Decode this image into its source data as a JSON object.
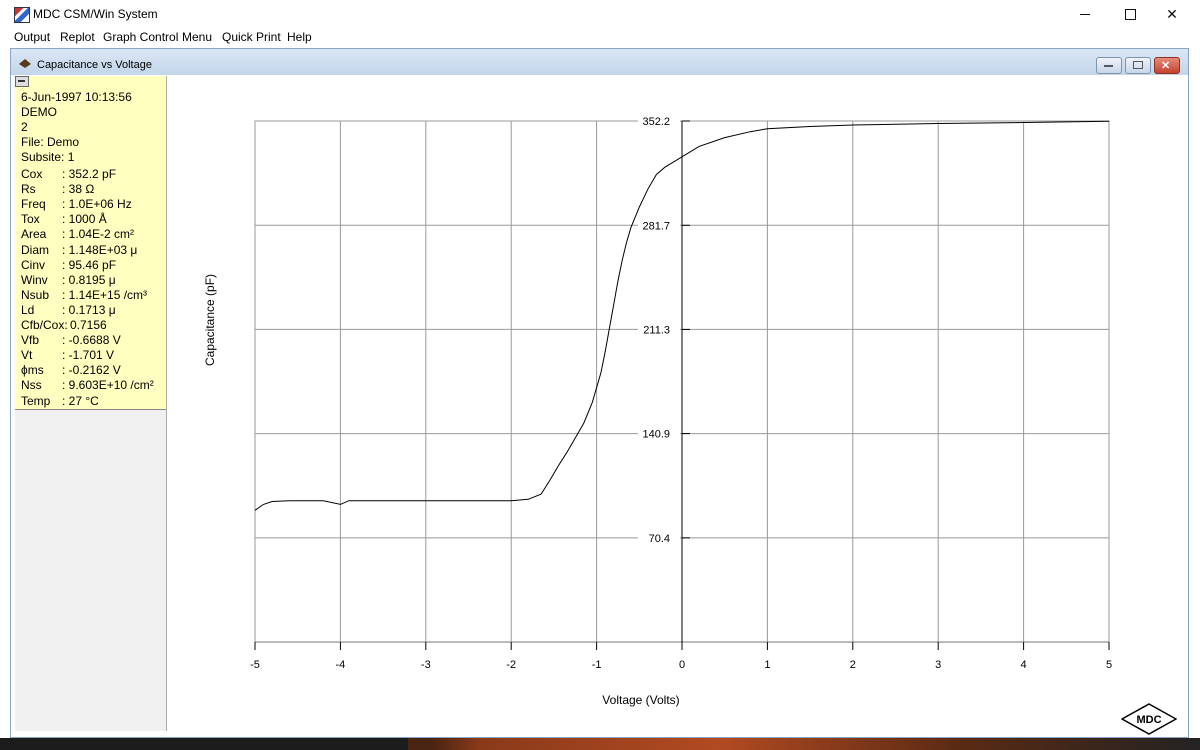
{
  "window": {
    "title": "MDC CSM/Win System"
  },
  "menu": [
    "Output",
    "Replot",
    "Graph Control",
    "Menu",
    "Quick Print",
    "Help"
  ],
  "child_window": {
    "title": "Capacitance vs Voltage"
  },
  "info": {
    "datetime": "6-Jun-1997 10:13:56",
    "name": "DEMO",
    "id": "2",
    "file": "File: Demo",
    "subsite": "Subsite: 1"
  },
  "params": [
    {
      "name": "Cox",
      "value": ": 352.2 pF"
    },
    {
      "name": "Rs",
      "value": ": 38 Ω"
    },
    {
      "name": "Freq",
      "value": ": 1.0E+06 Hz"
    },
    {
      "name": "Tox",
      "value": ": 1000 Å"
    },
    {
      "name": "Area",
      "value": ": 1.04E-2 cm²"
    },
    {
      "name": "Diam",
      "value": ": 1.148E+03 μ"
    },
    {
      "name": "Cinv",
      "value": ": 95.46 pF"
    },
    {
      "name": "Winv",
      "value": ": 0.8195 μ"
    },
    {
      "name": "Nsub",
      "value": ": 1.14E+15 /cm³"
    },
    {
      "name": "Ld",
      "value": ": 0.1713 μ"
    },
    {
      "name": "Cfb/Cox:",
      "value": "0.7156"
    },
    {
      "name": "Vfb",
      "value": ": -0.6688 V"
    },
    {
      "name": "Vt",
      "value": ": -1.701 V"
    },
    {
      "name": "ϕms",
      "value": ": -0.2162 V"
    },
    {
      "name": "Nss",
      "value": ": 9.603E+10 /cm²"
    },
    {
      "name": "Temp",
      "value": ": 27 °C"
    }
  ],
  "logo": {
    "text": "MDC"
  },
  "chart_data": {
    "type": "line",
    "title": "",
    "xlabel": "Voltage (Volts)",
    "ylabel": "Capacitance (pF)",
    "xlim": [
      -5,
      5
    ],
    "ylim": [
      0,
      352.2
    ],
    "x_ticks": [
      -5,
      -4,
      -3,
      -2,
      -1,
      0,
      1,
      2,
      3,
      4,
      5
    ],
    "y_ticks": [
      70.4,
      140.9,
      211.3,
      281.7,
      352.2
    ],
    "grid": true,
    "series": [
      {
        "x": [
          -5,
          -4.9,
          -4.8,
          -4.6,
          -4.2,
          -4.0,
          -3.9,
          -3.0,
          -2.0,
          -1.8,
          -1.65,
          -1.55,
          -1.45,
          -1.35,
          -1.25,
          -1.15,
          -1.05,
          -0.95,
          -0.9,
          -0.85,
          -0.8,
          -0.75,
          -0.7,
          -0.65,
          -0.6,
          -0.5,
          -0.4,
          -0.3,
          -0.2,
          0,
          0.2,
          0.5,
          0.8,
          1.0,
          1.5,
          2.0,
          3.0,
          4.0,
          5.0
        ],
        "y": [
          89,
          93,
          95,
          95.5,
          95.5,
          93,
          95.5,
          95.5,
          95.5,
          96.5,
          100,
          109,
          119,
          128,
          138,
          148,
          162,
          182,
          196,
          212,
          228,
          244,
          258,
          270,
          280,
          294,
          306,
          316,
          321,
          328,
          335,
          341,
          345,
          347,
          348.5,
          349.5,
          350.5,
          351.2,
          352
        ]
      }
    ]
  }
}
